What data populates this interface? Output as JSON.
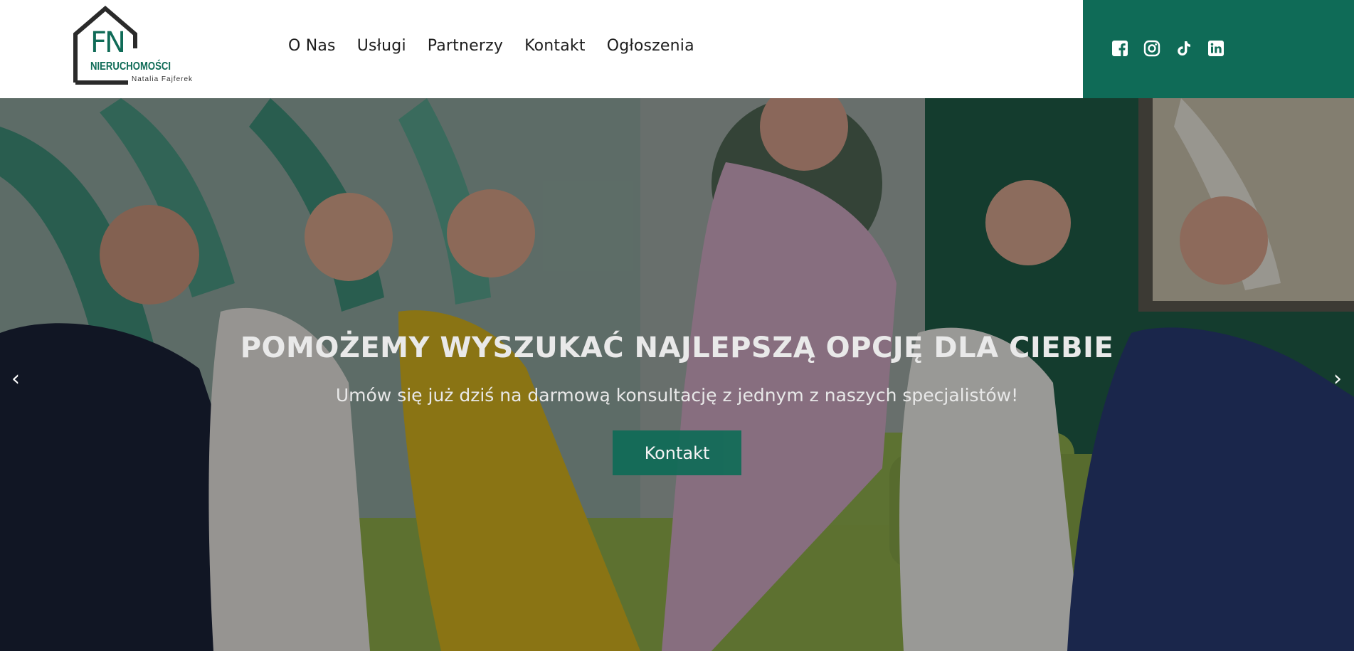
{
  "header": {
    "logo": {
      "initials": "FN",
      "brand": "NIERUCHOMOŚCI",
      "owner": "Natalia  Fajferek"
    },
    "nav": [
      "O Nas",
      "Usługi",
      "Partnerzy",
      "Kontakt",
      "Ogłoszenia"
    ],
    "social": {
      "background": "#0f6b57",
      "icons": [
        "facebook-icon",
        "instagram-icon",
        "tiktok-icon",
        "linkedin-icon"
      ]
    }
  },
  "hero": {
    "title": "POMOŻEMY WYSZUKAĆ NAJLEPSZĄ OPCJĘ DLA CIEBIE",
    "subtitle": "Umów się już dziś na darmową konsultację z jednym z naszych specjalistów!",
    "button_label": "Kontakt",
    "prev_arrow": "‹",
    "next_arrow": "›"
  },
  "colors": {
    "accent": "#0f6b57"
  }
}
